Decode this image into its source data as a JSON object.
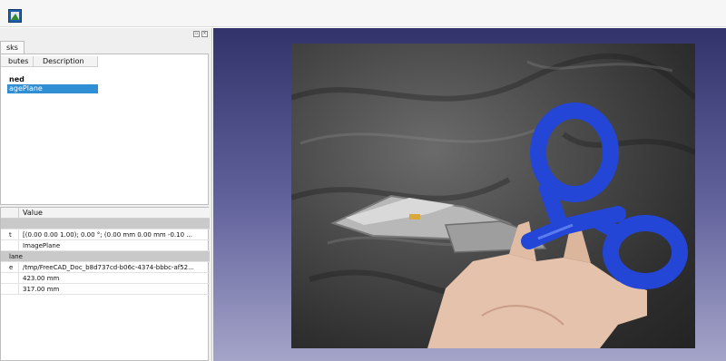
{
  "left_panel": {
    "tab_label": "sks",
    "dock_float_icon": "float-icon",
    "dock_close_icon": "close-icon",
    "tree": {
      "columns": [
        "butes",
        "Description"
      ],
      "group_label": "ned",
      "selected_item": "agePlane"
    },
    "properties": {
      "value_header": "Value",
      "rows": [
        {
          "key": "",
          "value": "",
          "group": true
        },
        {
          "key": "t",
          "value": "[(0.00 0.00 1.00); 0.00 °; (0.00 mm  0.00 mm  -0.10 ...",
          "group": false
        },
        {
          "key": "",
          "value": "ImagePlane",
          "group": false
        },
        {
          "key": "lane",
          "value": "",
          "group": true
        },
        {
          "key": "e",
          "value": "/tmp/FreeCAD_Doc_b8d737cd-b06c-4374-bbbc-af52...",
          "group": false
        },
        {
          "key": "",
          "value": "423.00 mm",
          "group": false
        },
        {
          "key": "",
          "value": "317.00 mm",
          "group": false
        }
      ]
    }
  },
  "viewport": {
    "background_top": "#33336b",
    "background_bottom": "#a4a4c8",
    "image_description_icon": "image-plane-photo"
  },
  "colors": {
    "selection": "#2f8ed4",
    "scissors_handle": "#2346d6"
  }
}
